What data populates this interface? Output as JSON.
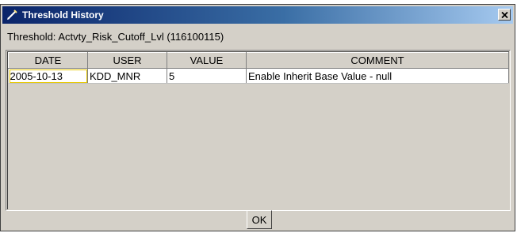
{
  "window": {
    "title": "Threshold History",
    "threshold_label": "Threshold: Actvty_Risk_Cutoff_Lvl (116100115)"
  },
  "table": {
    "columns": [
      "DATE",
      "USER",
      "VALUE",
      "COMMENT"
    ],
    "rows": [
      [
        "2005-10-13",
        "KDD_MNR",
        "5",
        "Enable Inherit Base Value - null"
      ]
    ]
  },
  "buttons": {
    "ok_label": "OK"
  },
  "icons": {
    "title_icon": "pencil-icon",
    "close_icon": "close-icon"
  },
  "colors": {
    "titlebar_start": "#0a246a",
    "titlebar_end": "#a6caf0",
    "selected_cell_border": "#e6c700"
  }
}
